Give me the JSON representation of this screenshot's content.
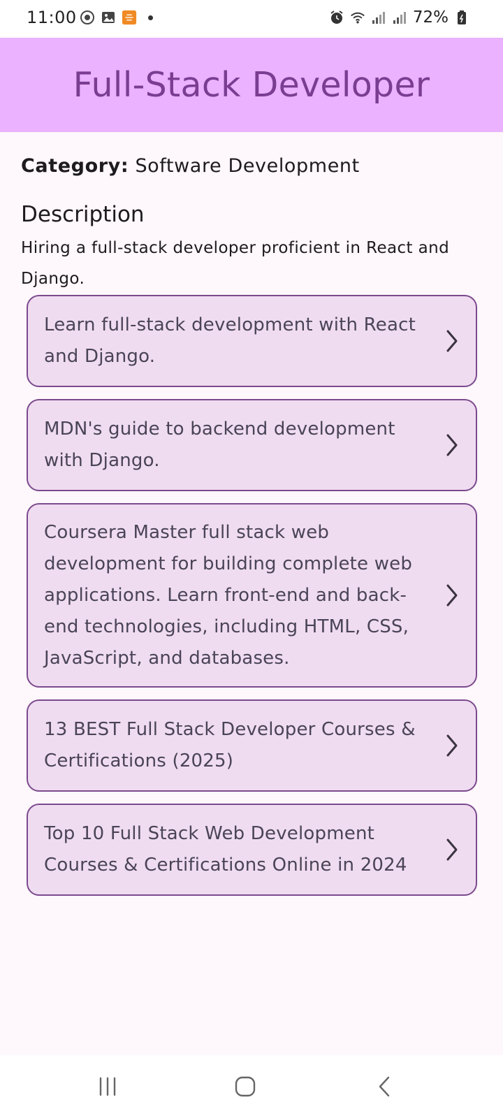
{
  "status_bar": {
    "time": "11:00",
    "battery": "72%",
    "left_icons": [
      "location-sync-icon",
      "gallery-icon",
      "app-notification-icon"
    ],
    "right_icons": [
      "alarm-icon",
      "wifi-icon",
      "signal-icon",
      "signal-icon",
      "battery-icon"
    ]
  },
  "app_bar": {
    "title": "Full-Stack Developer",
    "background": "#eab2ff",
    "title_color": "#7a3d91"
  },
  "details": {
    "category_label": "Category:",
    "category_value": "Software Development",
    "description_heading": "Description",
    "description_body": "Hiring a full-stack developer proficient in React and Django."
  },
  "courses": [
    {
      "text": "Learn full-stack development with React and Django."
    },
    {
      "text": "MDN's guide to backend development with Django."
    },
    {
      "text": "Coursera Master full stack web development for building complete web applications. Learn front-end and back-end technologies, including HTML, CSS, JavaScript, and databases."
    },
    {
      "text": "13 BEST Full Stack Developer Courses & Certifications (2025)"
    },
    {
      "text": "Top 10 Full Stack Web Development Courses & Certifications Online in 2024"
    }
  ],
  "nav_bar": {
    "buttons": [
      "recent-apps-icon",
      "home-icon",
      "back-icon"
    ]
  }
}
